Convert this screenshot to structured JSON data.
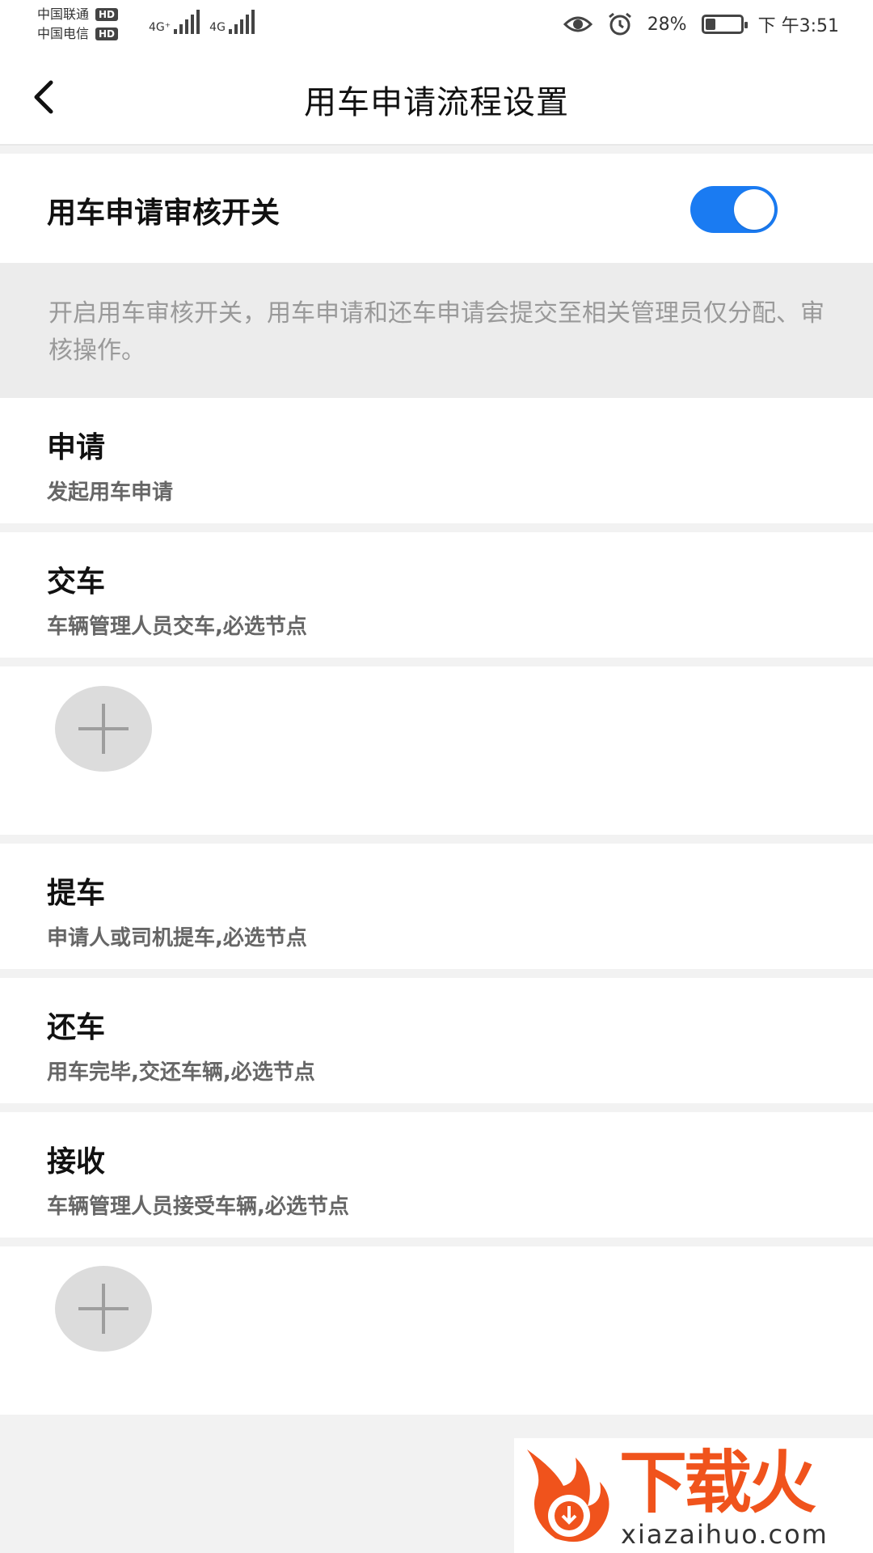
{
  "status_bar": {
    "carrier1": "中国联通",
    "carrier2": "中国电信",
    "hd_label": "HD",
    "net1": "4G⁺",
    "net2": "4G",
    "battery_percent": "28%",
    "battery_level": 0.28,
    "time": "下 午3:51",
    "icons": [
      "eye-icon",
      "alarm-icon",
      "battery-icon"
    ]
  },
  "header": {
    "back_icon": "chevron-left-icon",
    "title": "用车申请流程设置"
  },
  "toggle": {
    "label": "用车申请审核开关",
    "enabled": true,
    "on_color": "#1a7bf2"
  },
  "description": "开启用车审核开关，用车申请和还车申请会提交至相关管理员仅分配、审核操作。",
  "steps": [
    {
      "title": "申请",
      "desc": "发起用车申请"
    },
    {
      "title": "交车",
      "desc": "车辆管理人员交车,必选节点"
    },
    {
      "title": "提车",
      "desc": "申请人或司机提车,必选节点"
    },
    {
      "title": "还车",
      "desc": "用车完毕,交还车辆,必选节点"
    },
    {
      "title": "接收",
      "desc": "车辆管理人员接受车辆,必选节点"
    }
  ],
  "add_icon": "plus-icon",
  "watermark": {
    "text": "下载火",
    "url": "xiazaihuo.com",
    "color": "#f0531c"
  }
}
